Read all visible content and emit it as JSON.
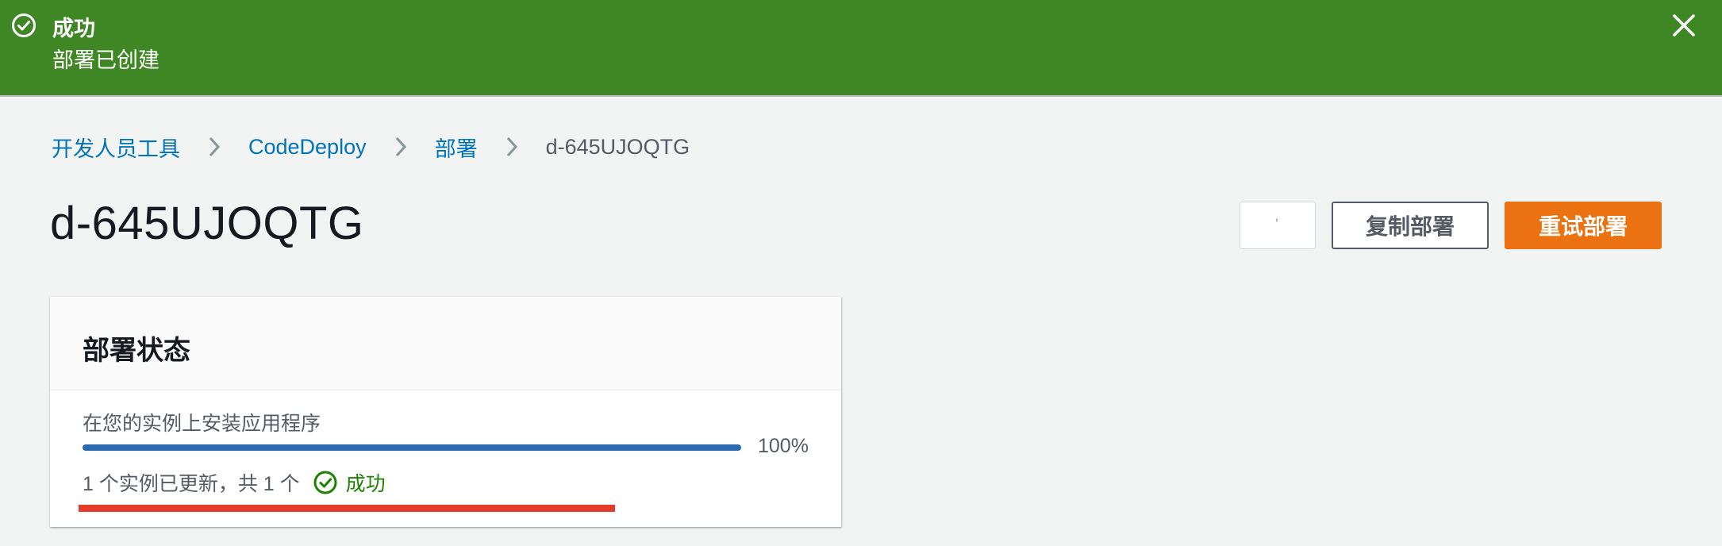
{
  "flash": {
    "title": "成功",
    "message": "部署已创建",
    "icon": "check-circle-icon",
    "close_icon": "close-icon",
    "color": "#3f8624"
  },
  "breadcrumbs": {
    "items": [
      {
        "label": "开发人员工具"
      },
      {
        "label": "CodeDeploy"
      },
      {
        "label": "部署"
      },
      {
        "label": "d-645UJOQTG"
      }
    ],
    "separator_icon": "chevron-right-icon"
  },
  "page": {
    "title": "d-645UJOQTG"
  },
  "actions": {
    "small_button_text": "ʼ",
    "copy_label": "复制部署",
    "retry_label": "重试部署",
    "accent": "#ec7211"
  },
  "status_panel": {
    "heading": "部署状态",
    "step_label": "在您的实例上安装应用程序",
    "progress_percent": 100,
    "progress_text": "100%",
    "summary": "1 个实例已更新，共 1 个",
    "status": "成功",
    "status_color": "#1d8102",
    "bar_color": "#2a6ab2"
  }
}
